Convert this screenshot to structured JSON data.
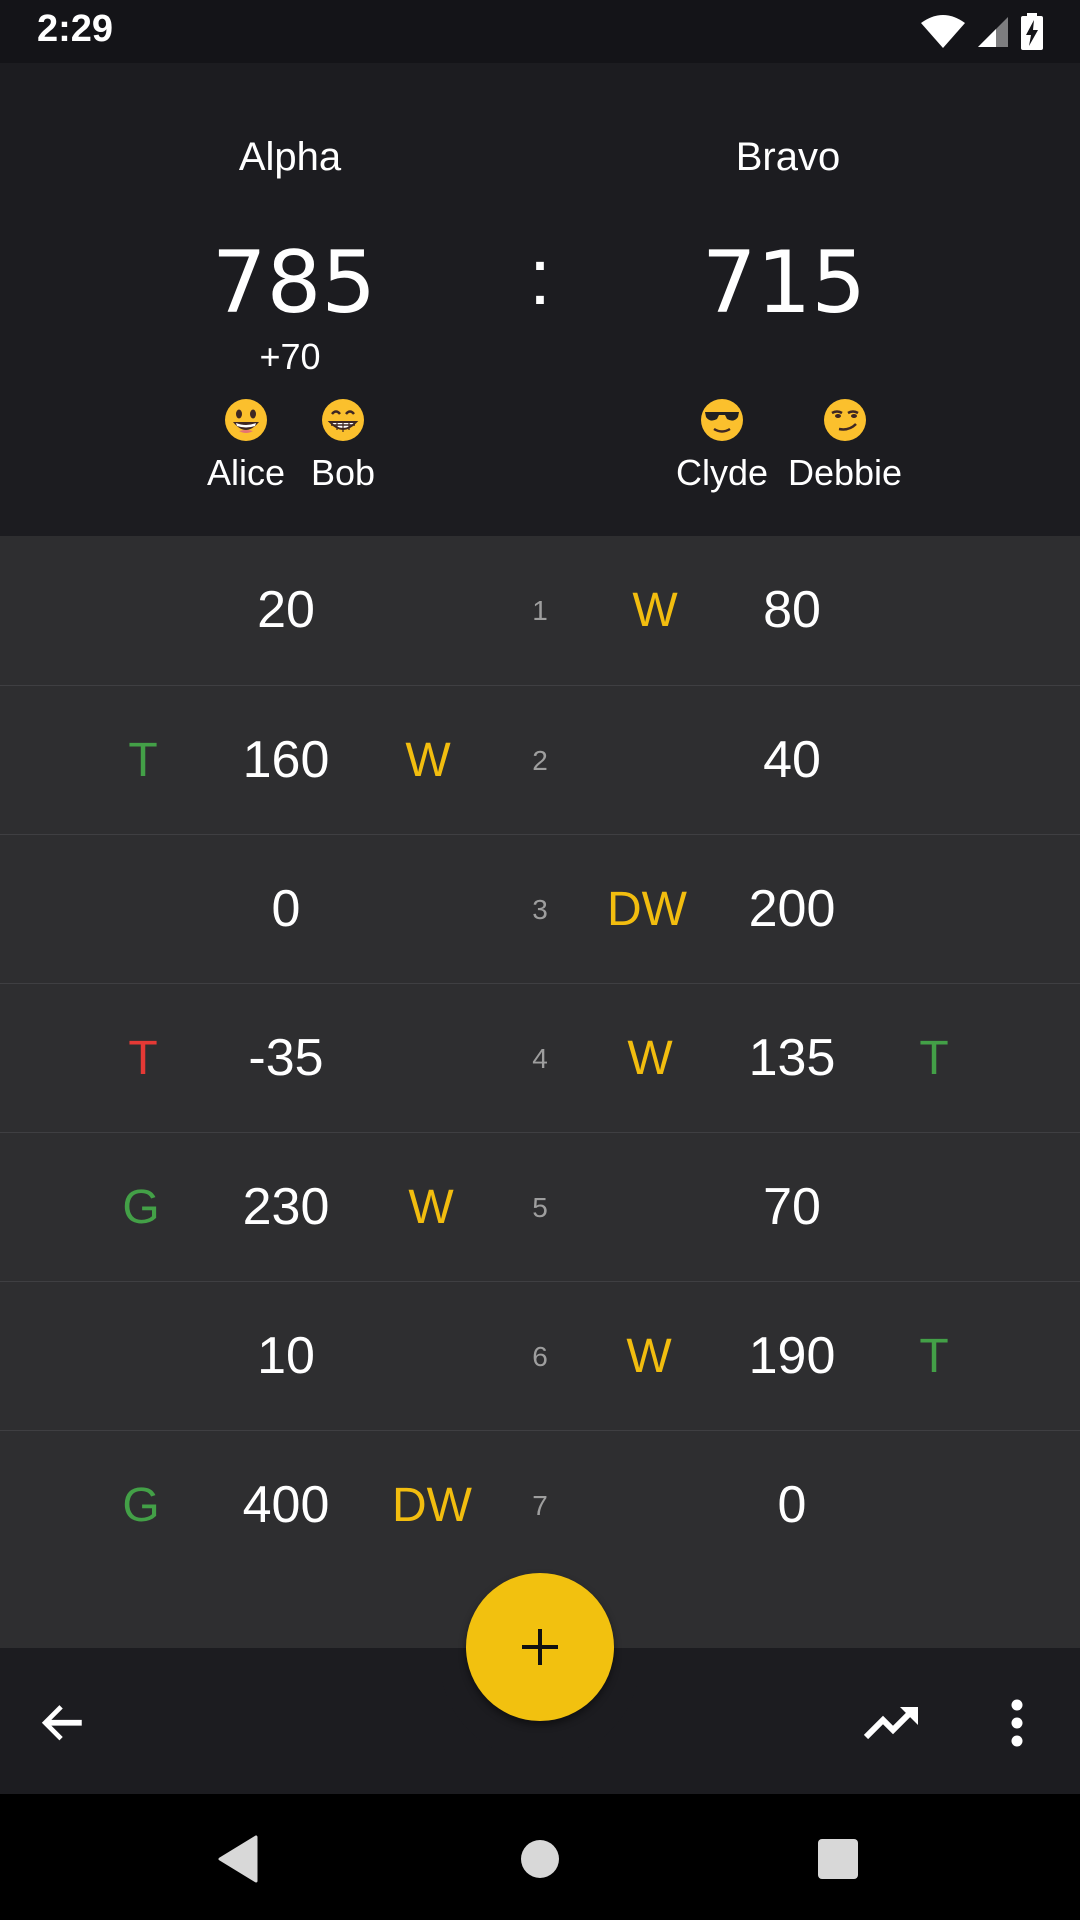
{
  "status_bar": {
    "time": "2:29",
    "icons": [
      "wifi-icon",
      "signal-icon",
      "battery-charging-icon"
    ]
  },
  "teams": [
    {
      "name": "Alpha",
      "score": "785",
      "delta": "+70",
      "players": [
        {
          "name": "Alice",
          "emoji": "grinning-face"
        },
        {
          "name": "Bob",
          "emoji": "grimacing-grin-face"
        }
      ]
    },
    {
      "name": "Bravo",
      "score": "715",
      "delta": "",
      "players": [
        {
          "name": "Clyde",
          "emoji": "sunglasses-face"
        },
        {
          "name": "Debbie",
          "emoji": "smirking-face"
        }
      ]
    }
  ],
  "separator": ":",
  "rounds": [
    {
      "number": "1",
      "left": {
        "points": "20",
        "pre": "",
        "pre_color": "",
        "post": "",
        "post_color": ""
      },
      "right": {
        "points": "80",
        "pre": "W",
        "pre_color": "#f2bd0f",
        "post": "",
        "post_color": ""
      }
    },
    {
      "number": "2",
      "left": {
        "points": "160",
        "pre": "T",
        "pre_color": "#43a047",
        "post": "W",
        "post_color": "#f2bd0f"
      },
      "right": {
        "points": "40",
        "pre": "",
        "pre_color": "",
        "post": "",
        "post_color": ""
      }
    },
    {
      "number": "3",
      "left": {
        "points": "0",
        "pre": "",
        "pre_color": "",
        "post": "",
        "post_color": ""
      },
      "right": {
        "points": "200",
        "pre": "DW",
        "pre_color": "#f2bd0f",
        "post": "",
        "post_color": ""
      }
    },
    {
      "number": "4",
      "left": {
        "points": "-35",
        "pre": "T",
        "pre_color": "#e53935",
        "post": "",
        "post_color": ""
      },
      "right": {
        "points": "135",
        "pre": "W",
        "pre_color": "#f2bd0f",
        "post": "T",
        "post_color": "#43a047"
      }
    },
    {
      "number": "5",
      "left": {
        "points": "230",
        "pre": "G",
        "pre_color": "#43a047",
        "post": "W",
        "post_color": "#f2bd0f"
      },
      "right": {
        "points": "70",
        "pre": "",
        "pre_color": "",
        "post": "",
        "post_color": ""
      }
    },
    {
      "number": "6",
      "left": {
        "points": "10",
        "pre": "",
        "pre_color": "",
        "post": "",
        "post_color": ""
      },
      "right": {
        "points": "190",
        "pre": "W",
        "pre_color": "#f2bd0f",
        "post": "T",
        "post_color": "#43a047"
      }
    },
    {
      "number": "7",
      "left": {
        "points": "400",
        "pre": "G",
        "pre_color": "#43a047",
        "post": "DW",
        "post_color": "#f2bd0f"
      },
      "right": {
        "points": "0",
        "pre": "",
        "pre_color": "",
        "post": "",
        "post_color": ""
      }
    }
  ],
  "bottom_bar": {
    "actions": [
      "back-arrow-icon",
      "add-icon",
      "trending-up-icon",
      "more-vert-icon"
    ],
    "fab_color": "#f2c10f"
  },
  "nav_bar": {
    "buttons": [
      "nav-back-icon",
      "nav-home-icon",
      "nav-recents-icon"
    ]
  },
  "colors": {
    "accent": "#f2c10f",
    "win": "#f2bd0f",
    "positive": "#43a047",
    "negative": "#e53935",
    "header_bg": "#1c1c20",
    "list_bg": "#2e2e30"
  }
}
